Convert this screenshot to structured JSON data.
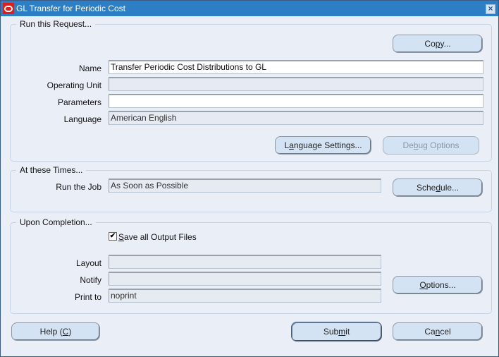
{
  "window": {
    "title": "GL Transfer for Periodic Cost",
    "close_icon": "×"
  },
  "run_request": {
    "legend": "Run this Request...",
    "copy_button": {
      "pre": "Co",
      "mnemonic": "p",
      "post": "y..."
    },
    "fields": [
      {
        "label": "Name",
        "value": "Transfer Periodic Cost Distributions to GL",
        "editable": true
      },
      {
        "label": "Operating Unit",
        "value": "",
        "editable": false
      },
      {
        "label": "Parameters",
        "value": "",
        "editable": true
      },
      {
        "label": "Language",
        "value": "American English",
        "editable": false
      }
    ],
    "language_settings_button": {
      "pre": "L",
      "mnemonic": "a",
      "post": "nguage Settings..."
    },
    "debug_options_button": {
      "pre": "De",
      "mnemonic": "b",
      "post": "ug Options",
      "enabled": false
    }
  },
  "at_times": {
    "legend": "At these Times...",
    "run_job_label": "Run the Job",
    "run_job_value": "As Soon as Possible",
    "schedule_button": {
      "pre": "Sche",
      "mnemonic": "d",
      "post": "ule..."
    }
  },
  "upon_completion": {
    "legend": "Upon Completion...",
    "save_output": {
      "checked": true,
      "check_glyph": "✔",
      "mnemonic": "S",
      "post": "ave all Output Files"
    },
    "fields": [
      {
        "label": "Layout",
        "value": ""
      },
      {
        "label": "Notify",
        "value": ""
      },
      {
        "label": "Print to",
        "value": "noprint"
      }
    ],
    "options_button": {
      "pre": "",
      "mnemonic": "O",
      "post": "ptions..."
    }
  },
  "footer": {
    "help_button": {
      "pre": "Help (",
      "mnemonic": "C",
      "post": ")"
    },
    "submit_button": {
      "pre": "Sub",
      "mnemonic": "m",
      "post": "it"
    },
    "cancel_button": {
      "pre": "Ca",
      "mnemonic": "n",
      "post": "cel"
    }
  }
}
